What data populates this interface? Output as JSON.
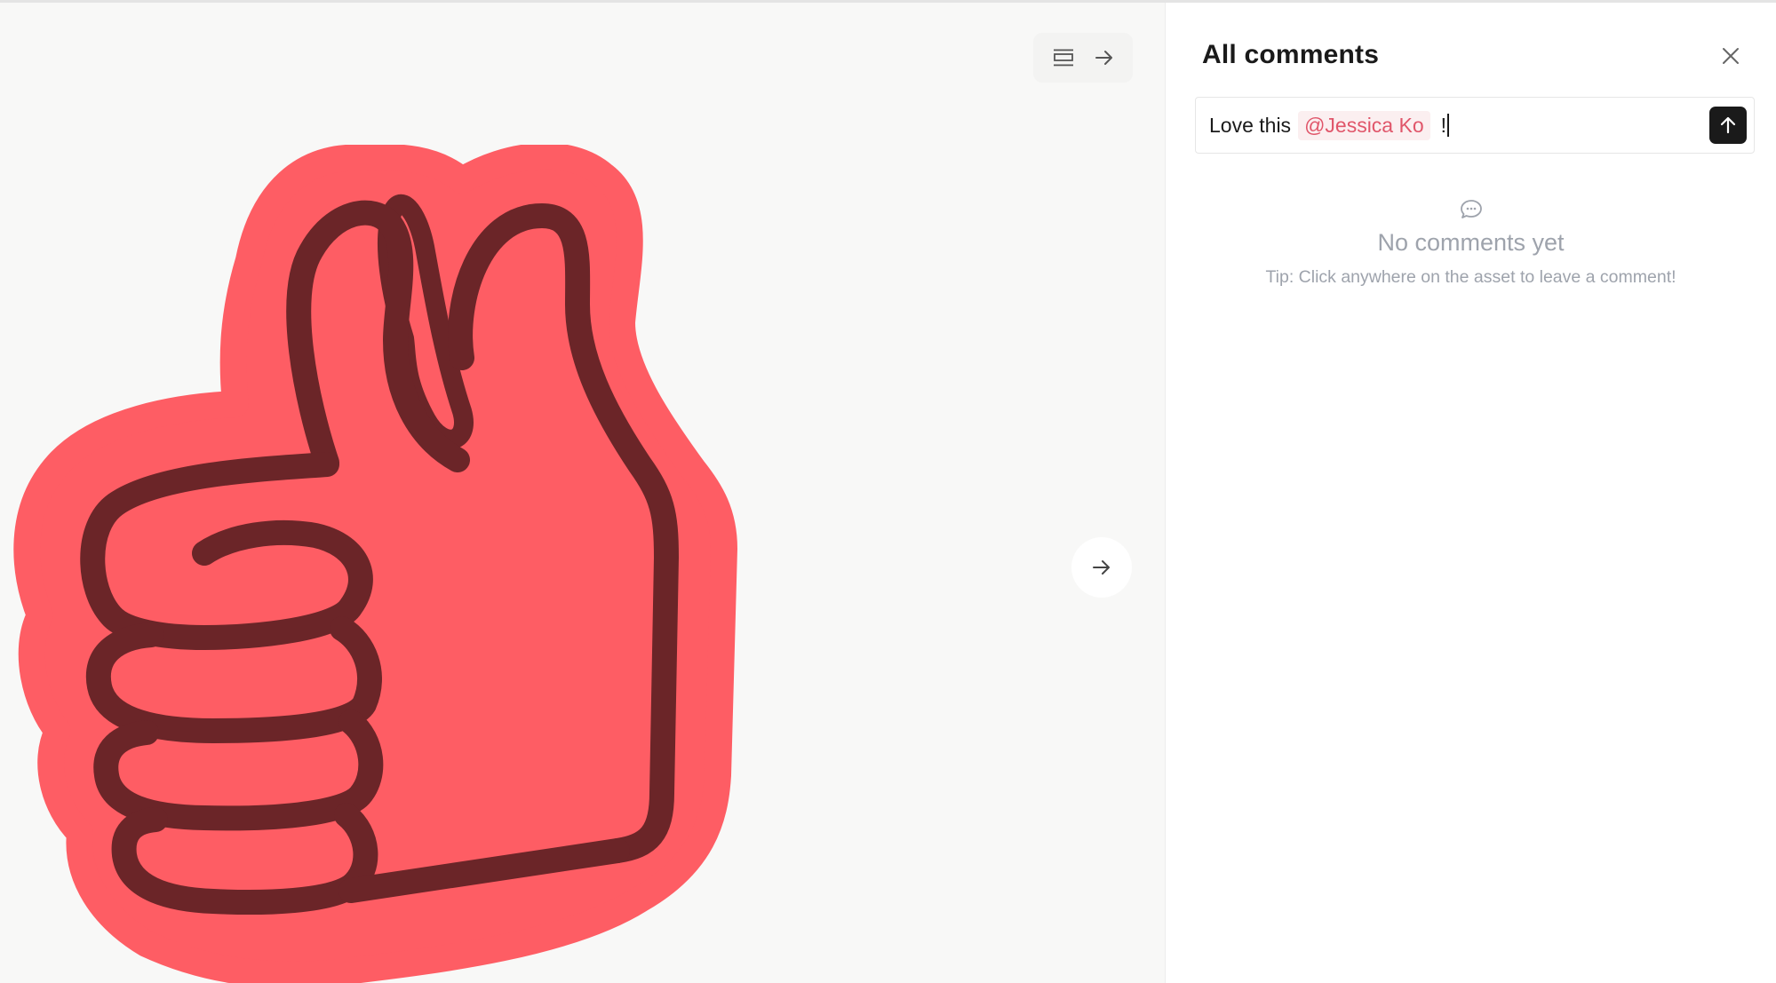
{
  "panel": {
    "title": "All comments",
    "close_icon": "close-icon"
  },
  "composer": {
    "text_before": "Love this",
    "mention": "@Jessica Ko",
    "text_after": "!",
    "send_icon": "arrow-up-icon"
  },
  "empty_state": {
    "icon": "chat-bubbles-icon",
    "title": "No comments yet",
    "tip": "Tip: Click anywhere on the asset to leave a comment!"
  },
  "canvas": {
    "toolbar_icons": [
      "list-layout-icon",
      "arrow-right-icon"
    ],
    "next_icon": "arrow-right-icon",
    "asset": "thumbs-up-sticker"
  },
  "colors": {
    "sticker_fill": "#fe5d64",
    "sticker_outline": "#6b2528",
    "mention_text": "#e0566a",
    "mention_bg": "#fbeff0",
    "muted_text": "#9ea3ac"
  }
}
